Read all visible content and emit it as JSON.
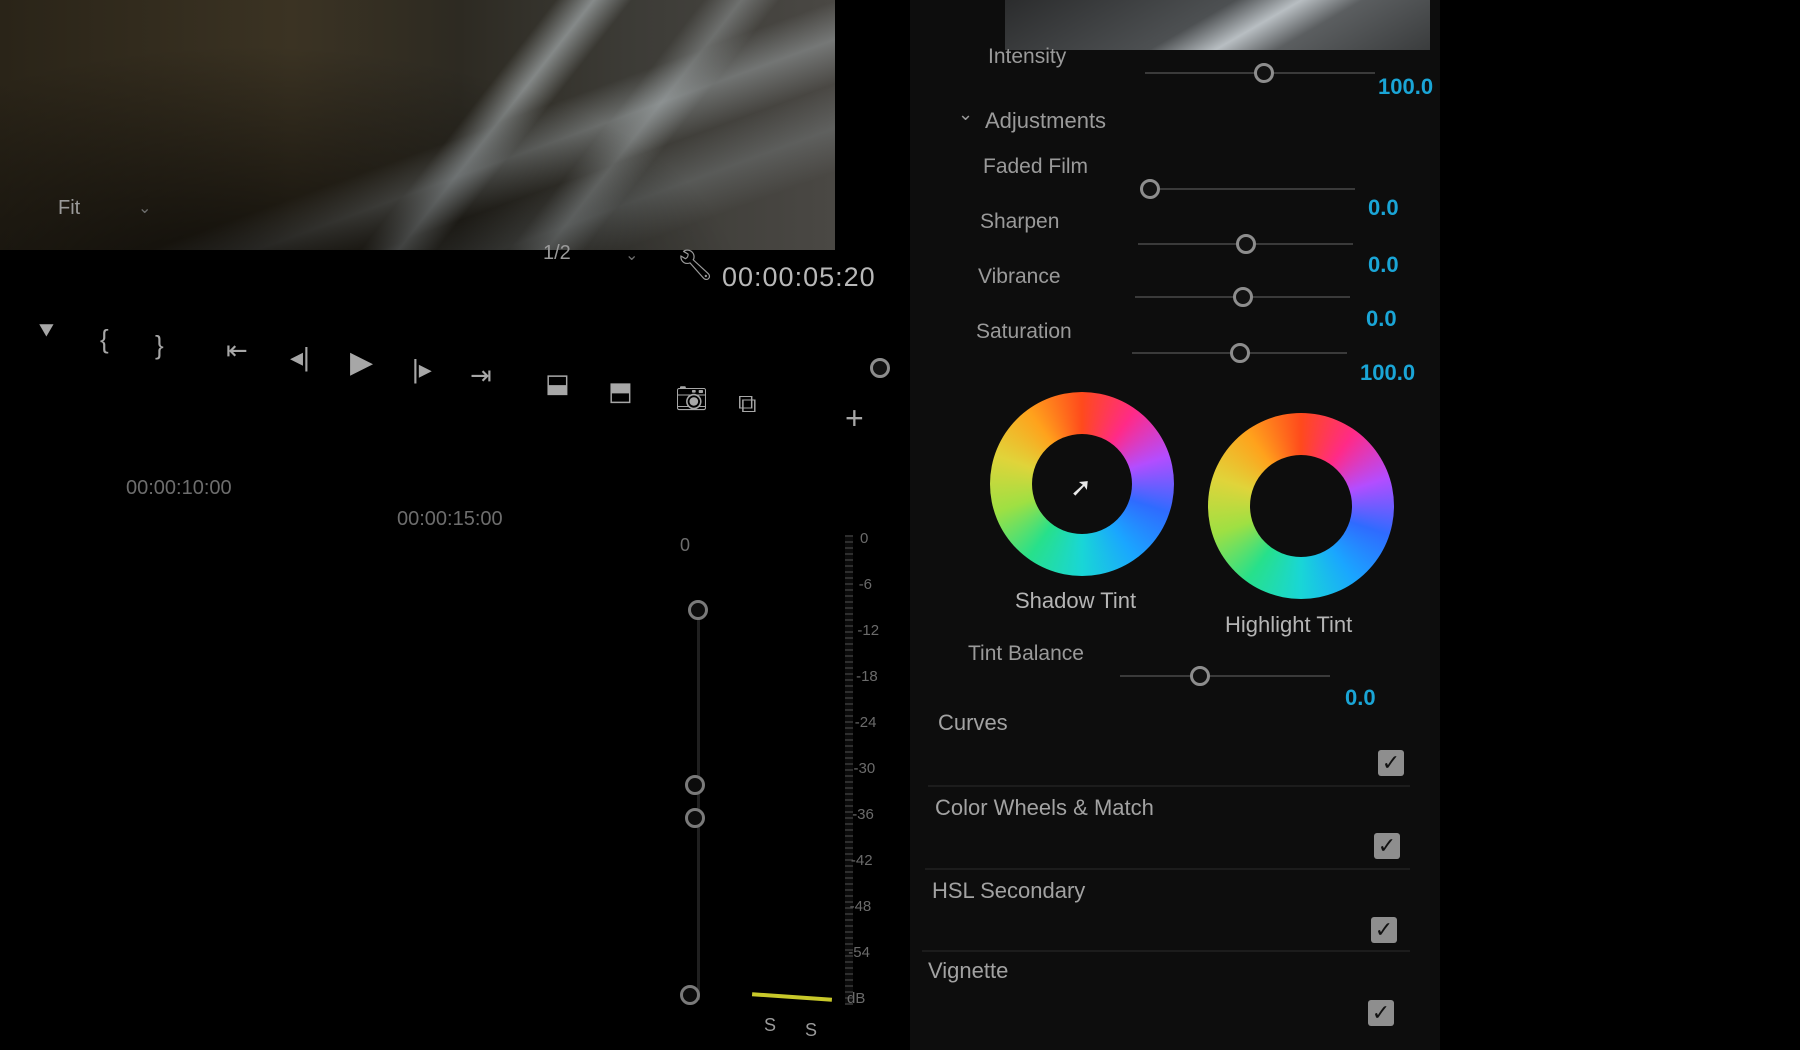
{
  "monitor": {
    "fit_label": "Fit",
    "resolution": "1/2",
    "timecode": "00:00:05:20"
  },
  "timeline": {
    "ruler": [
      "00:00:10:00",
      "00:00:15:00"
    ],
    "track_top_value": "0"
  },
  "audio_meter": {
    "scale": [
      "0",
      "-6",
      "-12",
      "-18",
      "-24",
      "-30",
      "-36",
      "-42",
      "-48",
      "-54",
      "dB"
    ],
    "solo_labels": [
      "S",
      "S"
    ]
  },
  "lumetri": {
    "intensity": {
      "label": "Intensity",
      "value": "100.0",
      "level": 0.52
    },
    "adjustments_label": "Adjustments",
    "sliders": [
      {
        "label": "Faded Film",
        "value": "0.0",
        "level": 0.0
      },
      {
        "label": "Sharpen",
        "value": "0.0",
        "level": 0.5
      },
      {
        "label": "Vibrance",
        "value": "0.0",
        "level": 0.5
      },
      {
        "label": "Saturation",
        "value": "100.0",
        "level": 0.5
      }
    ],
    "wheels": {
      "shadow_label": "Shadow Tint",
      "highlight_label": "Highlight Tint"
    },
    "tint_balance": {
      "label": "Tint Balance",
      "value": "0.0",
      "level": 0.5
    },
    "sections": [
      {
        "label": "Curves",
        "checked": true
      },
      {
        "label": "Color Wheels & Match",
        "checked": true
      },
      {
        "label": "HSL Secondary",
        "checked": true
      },
      {
        "label": "Vignette",
        "checked": true
      }
    ]
  },
  "colors": {
    "accent_value": "#1aa5d6",
    "panel_bg": "#0d0d0d"
  }
}
